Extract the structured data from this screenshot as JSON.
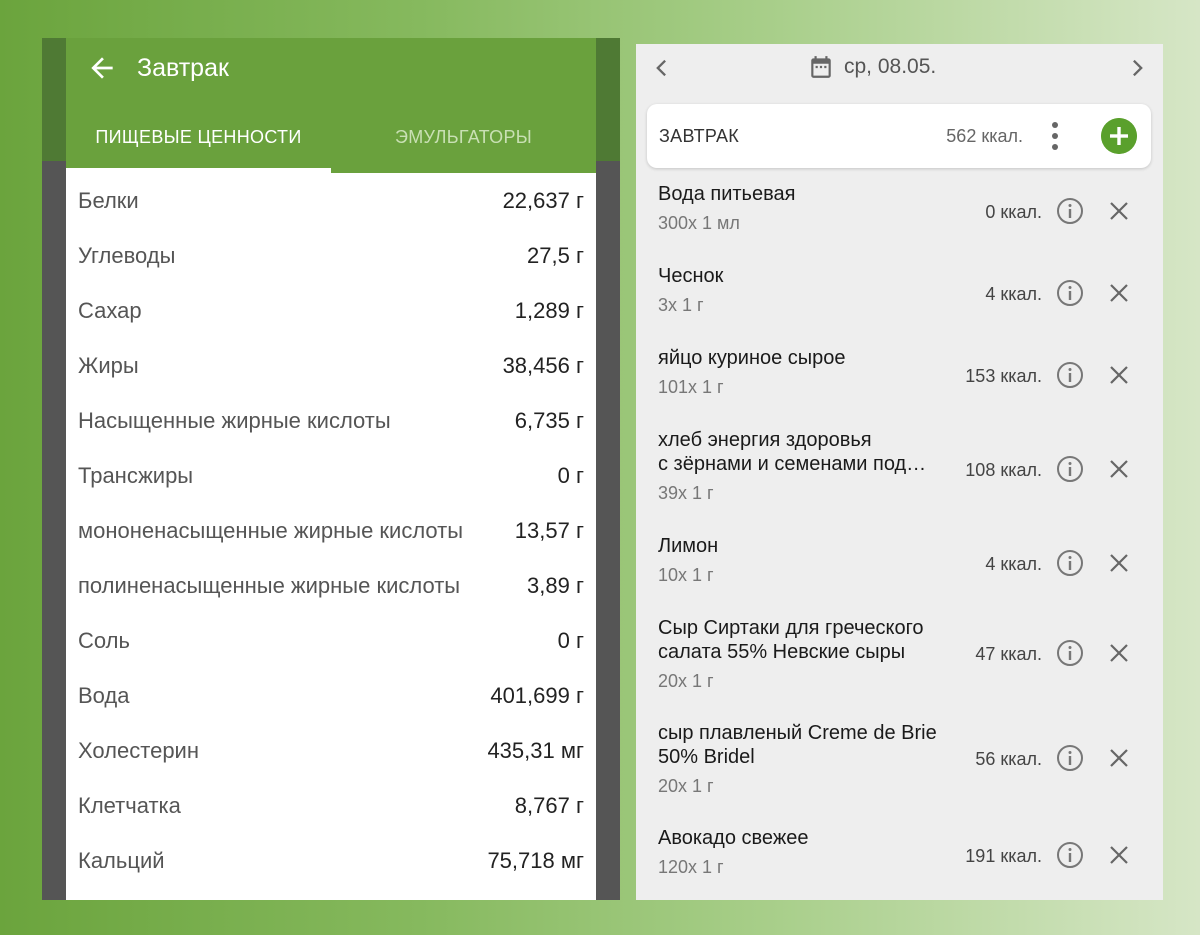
{
  "left": {
    "title": "Завтрак",
    "tabs": [
      {
        "label": "ПИЩЕВЫЕ ЦЕННОСТИ",
        "active": true
      },
      {
        "label": "ЭМУЛЬГАТОРЫ",
        "active": false
      }
    ],
    "nutrients": [
      {
        "name": "Белки",
        "value": "22,637 г"
      },
      {
        "name": "Углеводы",
        "value": "27,5 г"
      },
      {
        "name": "Сахар",
        "value": "1,289 г"
      },
      {
        "name": "Жиры",
        "value": "38,456 г"
      },
      {
        "name": "Насыщенные жирные кислоты",
        "value": "6,735 г"
      },
      {
        "name": "Трансжиры",
        "value": "0 г"
      },
      {
        "name": "мононенасыщенные жирные кислоты",
        "value": "13,57 г"
      },
      {
        "name": "полиненасыщенные жирные кислоты",
        "value": "3,89 г"
      },
      {
        "name": "Соль",
        "value": "0 г"
      },
      {
        "name": "Вода",
        "value": "401,699 г"
      },
      {
        "name": "Холестерин",
        "value": "435,31 мг"
      },
      {
        "name": "Клетчатка",
        "value": "8,767 г"
      },
      {
        "name": "Кальций",
        "value": "75,718 мг"
      }
    ],
    "colors": {
      "header": "#6aa13d"
    }
  },
  "right": {
    "date": "ср, 08.05.",
    "meal": {
      "name": "ЗАВТРАК",
      "kcal": "562 ккал."
    },
    "foods": [
      {
        "name": [
          "Вода питьевая"
        ],
        "qty": "300x 1 мл",
        "kcal": "0 ккал."
      },
      {
        "name": [
          "Чеснок"
        ],
        "qty": "3x 1 г",
        "kcal": "4 ккал."
      },
      {
        "name": [
          "яйцо куриное сырое"
        ],
        "qty": "101x 1 г",
        "kcal": "153 ккал."
      },
      {
        "name": [
          "хлеб энергия здоровья",
          "с зёрнами и семенами под…"
        ],
        "qty": "39x 1 г",
        "kcal": "108 ккал."
      },
      {
        "name": [
          "Лимон"
        ],
        "qty": "10x 1 г",
        "kcal": "4 ккал."
      },
      {
        "name": [
          "Сыр Сиртаки для греческого",
          "салата 55% Невские сыры"
        ],
        "qty": "20x 1 г",
        "kcal": "47 ккал."
      },
      {
        "name": [
          "сыр плавленый Creme de Brie",
          "50% Bridel"
        ],
        "qty": "20x 1 г",
        "kcal": "56 ккал."
      },
      {
        "name": [
          "Авокадо свежее"
        ],
        "qty": "120x 1 г",
        "kcal": "191 ккал."
      }
    ],
    "icons": {
      "prev": "chevron-left-icon",
      "next": "chevron-right-icon",
      "calendar": "calendar-icon",
      "menu": "more-vert-icon",
      "add": "plus-icon",
      "info": "info-icon",
      "delete": "close-icon"
    },
    "colors": {
      "accent": "#5aa02c",
      "background": "#eeeeee"
    }
  }
}
